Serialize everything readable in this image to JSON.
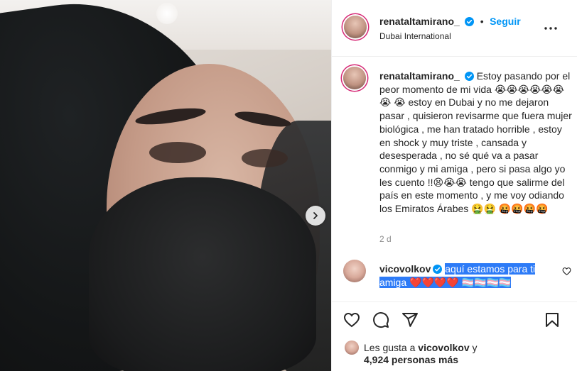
{
  "post": {
    "author": "renataltamirano_",
    "location": "Dubai International",
    "follow_label": "Seguir",
    "separator": "•",
    "caption": "Estoy pasando por el peor momento de mi vida 😭😭😭😭😭😭😭 😭 estoy en Dubai y no me dejaron pasar , quisieron revisarme que fuera mujer biológica , me han tratado horrible , estoy en shock y muy triste , cansada y desesperada , no sé qué va a pasar conmigo y mi amiga , pero si pasa algo yo les cuento !!😫😭😭 tengo que salirme del país en este momento , y me voy odiando los Emiratos Árabes 🤮🤮 🤬🤬🤬🤬",
    "time_ago": "2 d"
  },
  "comment": {
    "author": "vicovolkov",
    "text": "aquí estamos para ti amiga ❤️❤️❤️❤️ 🏳️‍⚧️🏳️‍⚧️🏳️‍⚧️🏳️‍⚧️"
  },
  "likes": {
    "prefix": "Les gusta a",
    "user": "vicovolkov",
    "suffix": "y",
    "count": "4,924 personas más"
  },
  "colors": {
    "accent_blue": "#0095f6",
    "selection": "#2d7bf7",
    "ring": "#d62976"
  }
}
